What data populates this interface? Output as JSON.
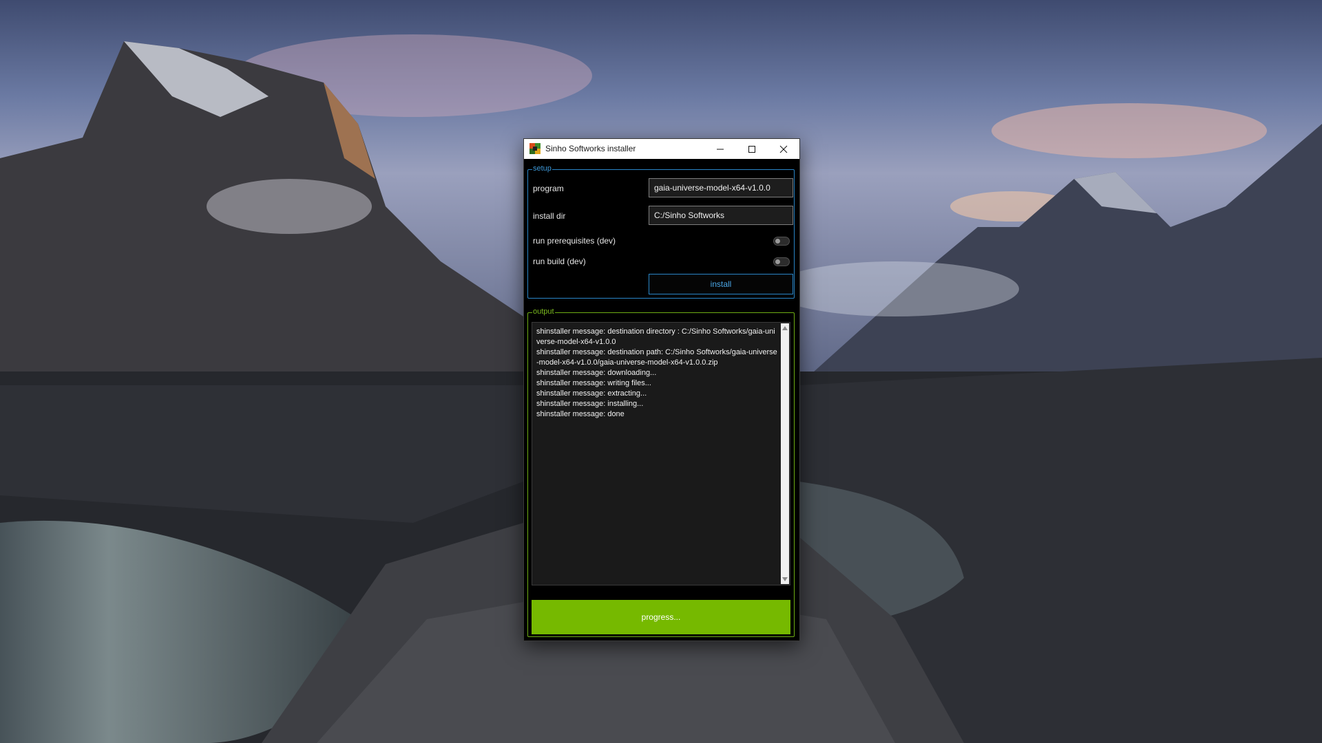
{
  "window": {
    "title": "Sinho Softworks installer",
    "controls": {
      "minimize": "minimize-icon",
      "maximize": "maximize-icon",
      "close": "close-icon"
    }
  },
  "setup": {
    "legend": "setup",
    "program_label": "program",
    "program_value": "gaia-universe-model-x64-v1.0.0",
    "install_dir_label": "install dir",
    "install_dir_value": "C:/Sinho Softworks",
    "run_prereq_label": "run prerequisites (dev)",
    "run_prereq_on": false,
    "run_build_label": "run build (dev)",
    "run_build_on": false,
    "install_button": "install"
  },
  "output": {
    "legend": "output",
    "lines": [
      "shinstaller message: destination directory : C:/Sinho Softworks/gaia-universe-model-x64-v1.0.0",
      "shinstaller message: destination path: C:/Sinho Softworks/gaia-universe-model-x64-v1.0.0/gaia-universe-model-x64-v1.0.0.zip",
      "shinstaller message: downloading...",
      "shinstaller message: writing files...",
      "shinstaller message: extracting...",
      "shinstaller message: installing...",
      "shinstaller message: done"
    ],
    "progress_label": "progress...",
    "progress_fraction": 1.0
  },
  "colors": {
    "setup_accent": "#2a86c8",
    "output_accent": "#6fae14",
    "progress_fill": "#76b900"
  }
}
